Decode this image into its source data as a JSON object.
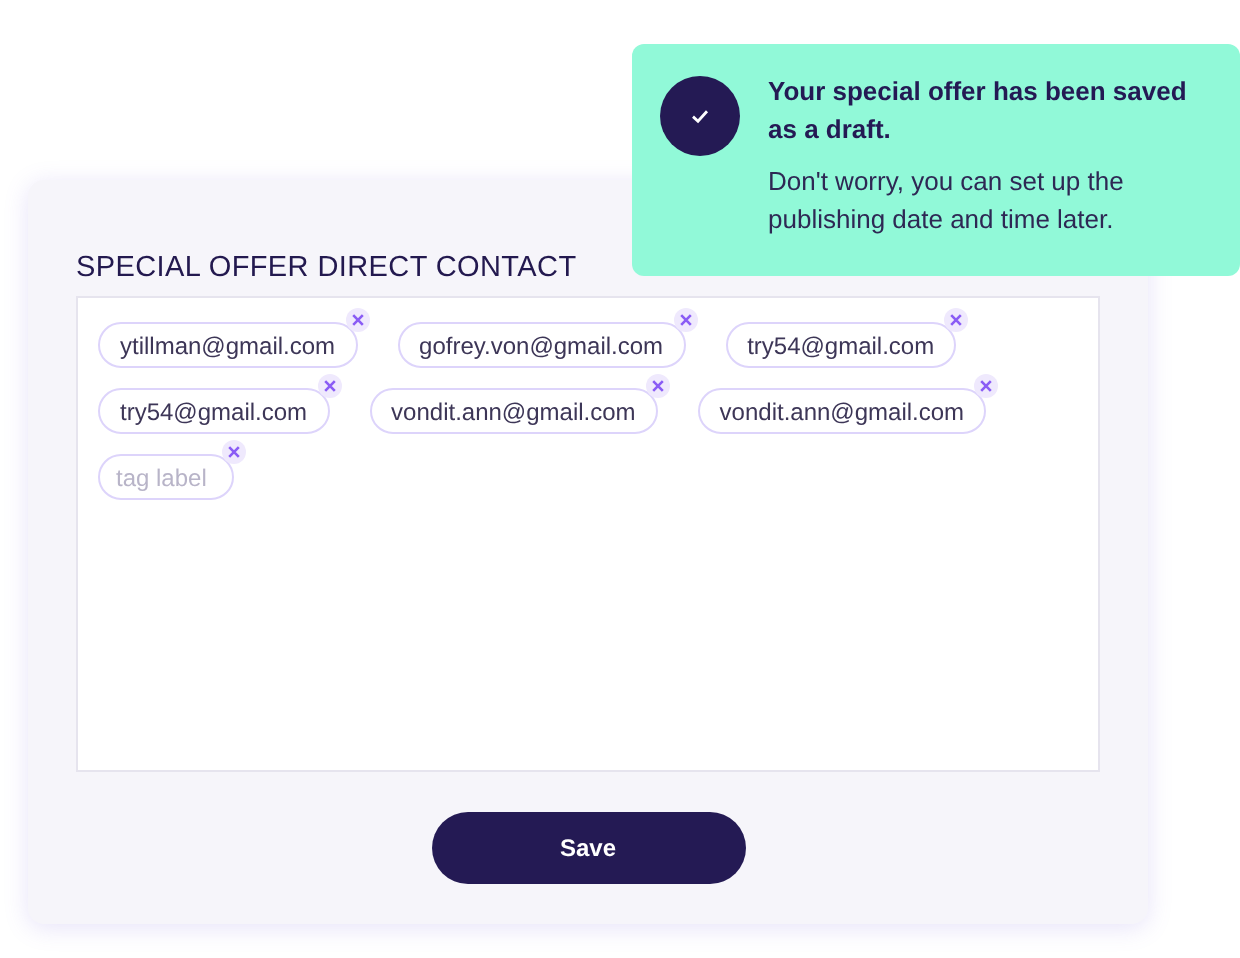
{
  "toast": {
    "title": "Your special offer has been saved as a draft.",
    "message": "Don't worry, you can set up the publishing date and time later."
  },
  "form": {
    "title": "SPECIAL OFFER DIRECT CONTACT",
    "tags": [
      "ytillman@gmail.com",
      "gofrey.von@gmail.com",
      "try54@gmail.com",
      "try54@gmail.com",
      "vondit.ann@gmail.com",
      "vondit.ann@gmail.com"
    ],
    "tag_input": {
      "placeholder": "tag label"
    },
    "save_button": "Save"
  }
}
